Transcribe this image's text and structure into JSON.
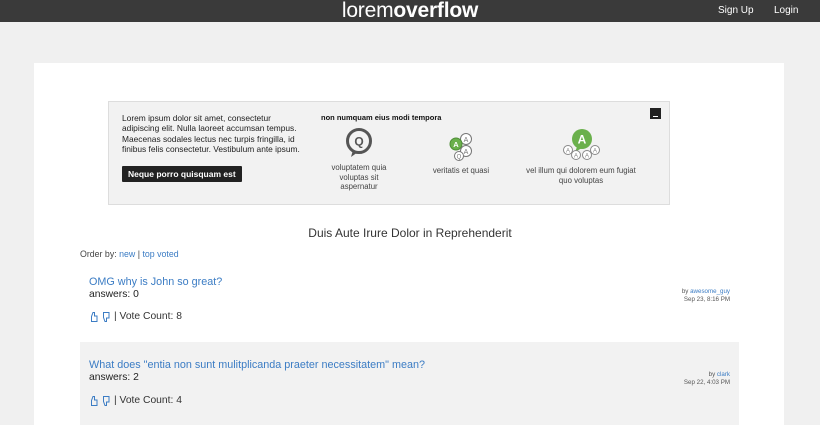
{
  "header": {
    "brand_light": "lorem",
    "brand_bold": "overflow",
    "signup_label": "Sign Up",
    "login_label": "Login"
  },
  "intro": {
    "text": "Lorem ipsum dolor sit amet, consectetur adipiscing elit. Nulla laoreet accumsan tempus. Maecenas sodales lectus nec turpis fringilla, id finibus felis consectetur. Vestibulum ante ipsum.",
    "button_label": "Neque porro quisquam est",
    "heading": "non numquam eius modi tempora",
    "features": [
      {
        "icon": "question-bubble-icon",
        "caption": "voluptatem quia voluptas sit aspernatur"
      },
      {
        "icon": "qa-bubbles-icon",
        "caption": "veritatis et quasi"
      },
      {
        "icon": "answer-bubbles-icon",
        "caption": "vel illum qui dolorem eum fugiat quo voluptas"
      }
    ]
  },
  "subtitle": "Duis Aute Irure Dolor in Reprehenderit",
  "order": {
    "label": "Order by:",
    "options": [
      "new",
      "top voted"
    ],
    "separator": "|"
  },
  "questions": [
    {
      "title": "OMG why is John so great?",
      "answers": "answers: 0",
      "by_label": "by",
      "author": "awesome_guy",
      "date": "Sep 23, 8:16 PM",
      "vote_count": "| Vote Count: 8"
    },
    {
      "title": "What does \"entia non sunt mulitplicanda praeter necessitatem\" mean?",
      "answers": "answers: 2",
      "by_label": "by",
      "author": "clark",
      "date": "Sep 22, 4:03 PM",
      "vote_count": "| Vote Count: 4"
    }
  ],
  "colors": {
    "topbar": "#3a3a3a",
    "link": "#3b7cc4",
    "accent_green": "#6ab04c",
    "icon_gray": "#555555"
  }
}
